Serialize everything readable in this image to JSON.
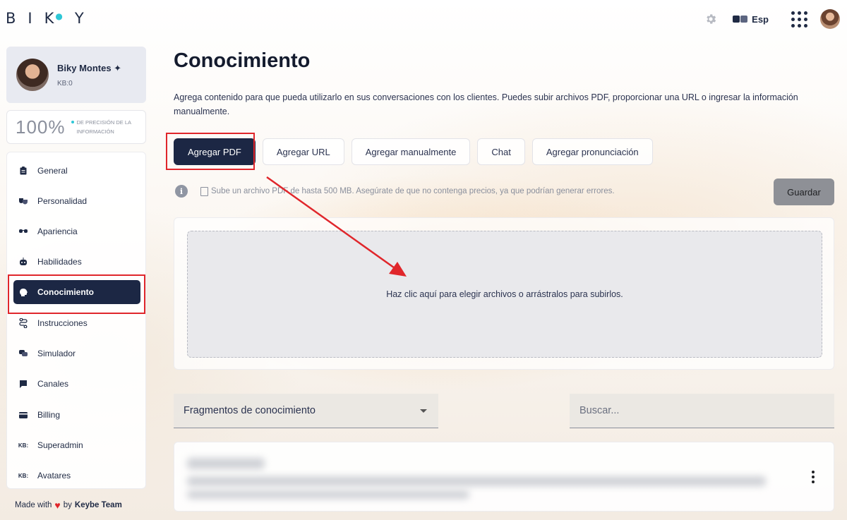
{
  "app": {
    "logo_letters": [
      "B",
      "I",
      "K",
      "Y"
    ]
  },
  "topbar": {
    "language": "Esp"
  },
  "profile": {
    "name": "Biky Montes ✦",
    "kb": "KB:0"
  },
  "precision": {
    "value": "100%",
    "label": "DE PRECISIÓN DE LA INFORMACIÓN"
  },
  "sidebar": {
    "items": [
      {
        "label": "General",
        "icon": "clipboard-icon"
      },
      {
        "label": "Personalidad",
        "icon": "masks-icon"
      },
      {
        "label": "Apariencia",
        "icon": "glasses-icon"
      },
      {
        "label": "Habilidades",
        "icon": "robot-icon"
      },
      {
        "label": "Conocimiento",
        "icon": "brain-icon",
        "active": true
      },
      {
        "label": "Instrucciones",
        "icon": "route-icon"
      },
      {
        "label": "Simulador",
        "icon": "chat-icon"
      },
      {
        "label": "Canales",
        "icon": "message-icon"
      },
      {
        "label": "Billing",
        "icon": "card-icon"
      },
      {
        "label": "Superadmin",
        "icon": "kb-icon"
      },
      {
        "label": "Avatares",
        "icon": "kb-icon"
      }
    ]
  },
  "footer": {
    "made_with": "Made with",
    "by": "by",
    "team": "Keybe Team"
  },
  "main": {
    "title": "Conocimiento",
    "description": "Agrega contenido para que pueda utilizarlo en sus conversaciones con los clientes. Puedes subir archivos PDF, proporcionar una URL o ingresar la información manualmente.",
    "tabs": [
      {
        "label": "Agregar PDF",
        "active": true
      },
      {
        "label": "Agregar URL"
      },
      {
        "label": "Agregar manualmente"
      },
      {
        "label": "Chat"
      },
      {
        "label": "Agregar pronunciación"
      }
    ],
    "hint": "Sube un archivo PDF de hasta 500 MB. Asegúrate de que no contenga precios, ya que podrían generar errores.",
    "save_label": "Guardar",
    "dropzone_text": "Haz clic aquí para elegir archivos o arrástralos para subirlos.",
    "fragments_select": "Fragmentos de conocimiento",
    "search_placeholder": "Buscar..."
  },
  "colors": {
    "primary": "#1c2744",
    "accent": "#2ec7d6",
    "highlight": "#e0262b"
  }
}
